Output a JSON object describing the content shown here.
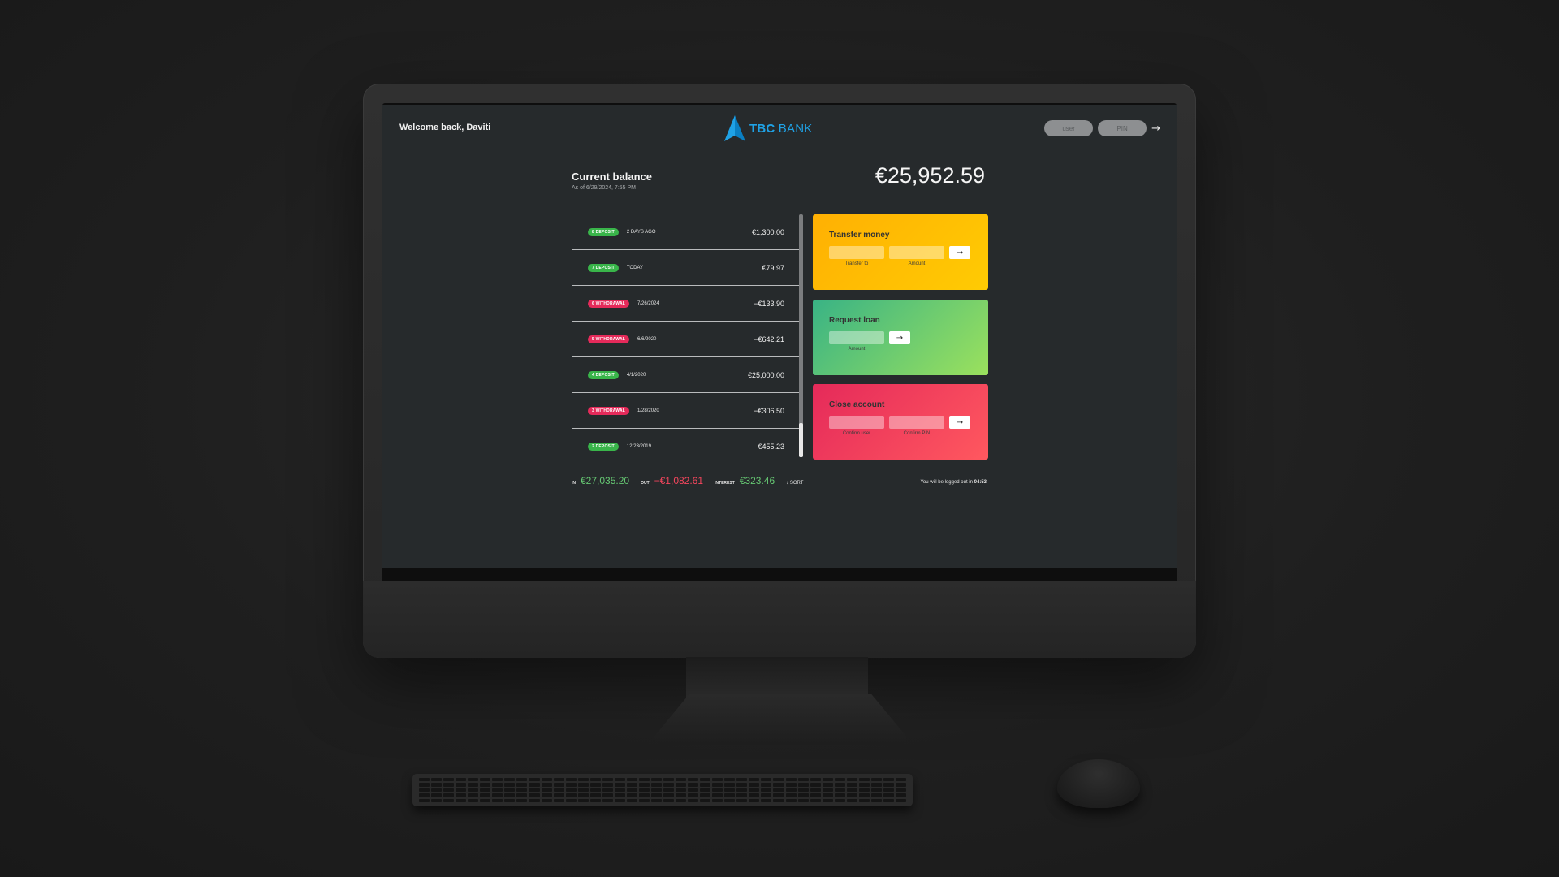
{
  "nav": {
    "welcome": "Welcome back, Daviti",
    "logo_bold": "TBC",
    "logo_rest": " BANK",
    "user_placeholder": "user",
    "pin_placeholder": "PIN",
    "login_label": "→",
    "logo_color": "#1fa2e6"
  },
  "balance": {
    "title": "Current balance",
    "date": "As of 6/29/2024, 7:55 PM",
    "value": "€25,952.59"
  },
  "movements": [
    {
      "type": "8 deposit",
      "kind": "deposit",
      "date": "2 days ago",
      "value": "€1,300.00"
    },
    {
      "type": "7 deposit",
      "kind": "deposit",
      "date": "today",
      "value": "€79.97"
    },
    {
      "type": "6 withdrawal",
      "kind": "withdrawal",
      "date": "7/26/2024",
      "value": "−€133.90"
    },
    {
      "type": "5 withdrawal",
      "kind": "withdrawal",
      "date": "6/6/2020",
      "value": "−€642.21"
    },
    {
      "type": "4 deposit",
      "kind": "deposit",
      "date": "4/1/2020",
      "value": "€25,000.00"
    },
    {
      "type": "3 withdrawal",
      "kind": "withdrawal",
      "date": "1/28/2020",
      "value": "−€306.50"
    },
    {
      "type": "2 deposit",
      "kind": "deposit",
      "date": "12/23/2019",
      "value": "€455.23"
    }
  ],
  "operations": {
    "transfer": {
      "title": "Transfer money",
      "label_to": "Transfer to",
      "label_amount": "Amount",
      "button": "→"
    },
    "loan": {
      "title": "Request loan",
      "label_amount": "Amount",
      "button": "→"
    },
    "close": {
      "title": "Close account",
      "label_user": "Confirm user",
      "label_pin": "Confirm PIN",
      "button": "→"
    }
  },
  "summary": {
    "in_label": "In",
    "in_value": "€27,035.20",
    "out_label": "Out",
    "out_value": "−€1,082.61",
    "interest_label": "Interest",
    "interest_value": "€323.46",
    "sort_label": "↓ SORT"
  },
  "logout": {
    "text": "You will be logged out in ",
    "time": "04:53"
  },
  "colors": {
    "deposit": "#39b54a",
    "withdrawal": "#e52a5a",
    "transfer": "#ffb003",
    "loan": "#39b385",
    "close": "#e52a5a"
  }
}
